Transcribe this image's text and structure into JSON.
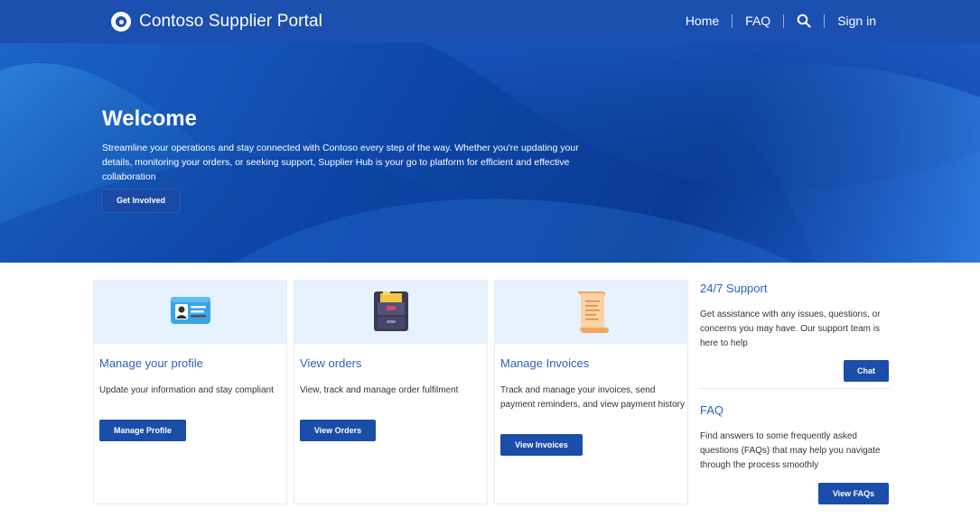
{
  "header": {
    "title": "Contoso Supplier Portal",
    "nav": {
      "home": "Home",
      "faq": "FAQ",
      "sign_in": "Sign in"
    }
  },
  "hero": {
    "title": "Welcome",
    "text": "Streamline your operations and stay connected with Contoso every step of the way. Whether you're updating your details, monitoring your orders, or seeking support, Supplier Hub is your go to platform for efficient and effective collaboration",
    "button": "Get Involved"
  },
  "cards": [
    {
      "title": "Manage your profile",
      "text": "Update your information and stay compliant",
      "button": "Manage Profile",
      "icon": "id-card-icon"
    },
    {
      "title": "View orders",
      "text": "View, track and manage order fulfilment",
      "button": "View Orders",
      "icon": "file-cabinet-icon"
    },
    {
      "title": "Manage Invoices",
      "text": "Track and manage your invoices, send payment reminders, and view payment history",
      "button": "View Invoices",
      "icon": "scroll-icon"
    }
  ],
  "support": {
    "title": "24/7 Support",
    "text": "Get assistance with any issues, questions, or concerns you may have. Our support team is here to help",
    "button": "Chat"
  },
  "faq": {
    "title": "FAQ",
    "text": "Find answers to some frequently asked questions (FAQs) that may help you navigate through the process smoothly",
    "button": "View FAQs"
  },
  "colors": {
    "header": "#1b4fb0",
    "button": "#1a4ea8",
    "accent_text": "#2b63b8",
    "card_header": "#e6f2fd"
  }
}
